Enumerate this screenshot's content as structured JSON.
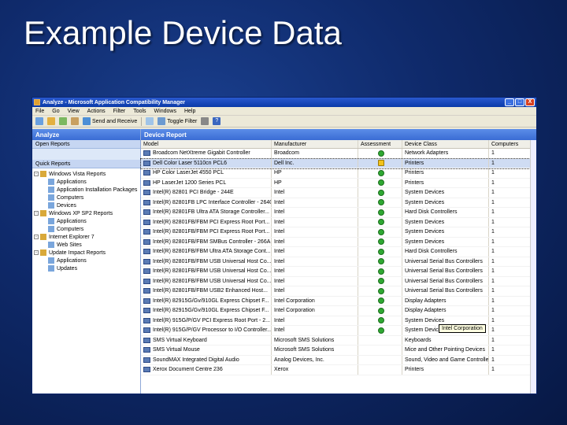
{
  "slide": {
    "title": "Example Device Data"
  },
  "window": {
    "title": "Analyze - Microsoft Application Compatibility Manager",
    "controls": [
      "_",
      "□",
      "X"
    ]
  },
  "menu": [
    "File",
    "Go",
    "View",
    "Actions",
    "Filter",
    "Tools",
    "Windows",
    "Help"
  ],
  "toolbar": {
    "send_receive": "Send and Receive",
    "toggle_filter": "Toggle Filter"
  },
  "left_pane": {
    "header": "Analyze",
    "open_reports": "Open Reports",
    "quick_reports": "Quick Reports",
    "tree": [
      {
        "label": "Windows Vista Reports",
        "level": 0,
        "exp": "-"
      },
      {
        "label": "Applications",
        "level": 1
      },
      {
        "label": "Application Installation Packages",
        "level": 1
      },
      {
        "label": "Computers",
        "level": 1
      },
      {
        "label": "Devices",
        "level": 1
      },
      {
        "label": "Windows XP SP2 Reports",
        "level": 0,
        "exp": "-"
      },
      {
        "label": "Applications",
        "level": 1
      },
      {
        "label": "Computers",
        "level": 1
      },
      {
        "label": "Internet Explorer 7",
        "level": 0,
        "exp": "-"
      },
      {
        "label": "Web Sites",
        "level": 1
      },
      {
        "label": "Update Impact Reports",
        "level": 0,
        "exp": "-"
      },
      {
        "label": "Applications",
        "level": 1
      },
      {
        "label": "Updates",
        "level": 1
      }
    ]
  },
  "report": {
    "header": "Device Report",
    "columns": [
      "Model",
      "Manufacturer",
      "Assessment",
      "Device Class",
      "Computers"
    ],
    "rows": [
      {
        "model": "Broadcom NetXtreme Gigabit Controller",
        "mfr": "Broadcom",
        "status": "ok",
        "cls": "Network Adapters",
        "comp": "1"
      },
      {
        "model": "Dell Color Laser 5110cn PCL6",
        "mfr": "Dell Inc.",
        "status": "warn",
        "cls": "Printers",
        "comp": "1"
      },
      {
        "model": "HP Color LaserJet 4550 PCL",
        "mfr": "HP",
        "status": "ok",
        "cls": "Printers",
        "comp": "1"
      },
      {
        "model": "HP LaserJet 1200 Series PCL",
        "mfr": "HP",
        "status": "ok",
        "cls": "Printers",
        "comp": "1"
      },
      {
        "model": "Intel(R) 82801 PCI Bridge - 244E",
        "mfr": "Intel",
        "status": "ok",
        "cls": "System Devices",
        "comp": "1"
      },
      {
        "model": "Intel(R) 82801FB LPC Interface Controller - 2640",
        "mfr": "Intel",
        "status": "ok",
        "cls": "System Devices",
        "comp": "1"
      },
      {
        "model": "Intel(R) 82801FB Ultra ATA Storage Controller...",
        "mfr": "Intel",
        "status": "ok",
        "cls": "Hard Disk Controllers",
        "comp": "1"
      },
      {
        "model": "Intel(R) 82801FB/FBM PCI Express Root Port...",
        "mfr": "Intel",
        "status": "ok",
        "cls": "System Devices",
        "comp": "1"
      },
      {
        "model": "Intel(R) 82801FB/FBM PCI Express Root Port...",
        "mfr": "Intel",
        "status": "ok",
        "cls": "System Devices",
        "comp": "1"
      },
      {
        "model": "Intel(R) 82801FB/FBM SMBus Controller - 266A",
        "mfr": "Intel",
        "status": "ok",
        "cls": "System Devices",
        "comp": "1"
      },
      {
        "model": "Intel(R) 82801FB/FBM Ultra ATA Storage Cont...",
        "mfr": "Intel",
        "status": "ok",
        "cls": "Hard Disk Controllers",
        "comp": "1"
      },
      {
        "model": "Intel(R) 82801FB/FBM USB Universal Host Co...",
        "mfr": "Intel",
        "status": "ok",
        "cls": "Universal Serial Bus Controllers",
        "comp": "1"
      },
      {
        "model": "Intel(R) 82801FB/FBM USB Universal Host Co...",
        "mfr": "Intel",
        "status": "ok",
        "cls": "Universal Serial Bus Controllers",
        "comp": "1"
      },
      {
        "model": "Intel(R) 82801FB/FBM USB Universal Host Co...",
        "mfr": "Intel",
        "status": "ok",
        "cls": "Universal Serial Bus Controllers",
        "comp": "1"
      },
      {
        "model": "Intel(R) 82801FB/FBM USB2 Enhanced Host...",
        "mfr": "Intel",
        "status": "ok",
        "cls": "Universal Serial Bus Controllers",
        "comp": "1"
      },
      {
        "model": "Intel(R) 82915G/Gv/910GL Express Chipset F...",
        "mfr": "Intel Corporation",
        "status": "ok",
        "cls": "Display Adapters",
        "comp": "1"
      },
      {
        "model": "Intel(R) 82915G/Gv/910GL Express Chipset F...",
        "mfr": "Intel Corporation",
        "status": "ok",
        "cls": "Display Adapters",
        "comp": "1"
      },
      {
        "model": "Intel(R) 915G/P/GV PCI Express Root Port - 2...",
        "mfr": "Intel",
        "status": "ok",
        "cls": "System Devices",
        "comp": "1"
      },
      {
        "model": "Intel(R) 915G/P/GV Processor to I/O Controller...",
        "mfr": "Intel",
        "status": "ok",
        "cls": "System Devices",
        "comp": "1"
      },
      {
        "model": "SMS Virtual Keyboard",
        "mfr": "Microsoft SMS Solutions",
        "status": "none",
        "cls": "Keyboards",
        "comp": "1"
      },
      {
        "model": "SMS Virtual Mouse",
        "mfr": "Microsoft SMS Solutions",
        "status": "none",
        "cls": "Mice and Other Pointing Devices",
        "comp": "1"
      },
      {
        "model": "SoundMAX Integrated Digital Audio",
        "mfr": "Analog Devices, Inc.",
        "status": "none",
        "cls": "Sound, Video and Game Controllers",
        "comp": "1"
      },
      {
        "model": "Xerox Document Centre 236",
        "mfr": "Xerox",
        "status": "none",
        "cls": "Printers",
        "comp": "1"
      }
    ],
    "tooltip": "Intel Corporation"
  }
}
